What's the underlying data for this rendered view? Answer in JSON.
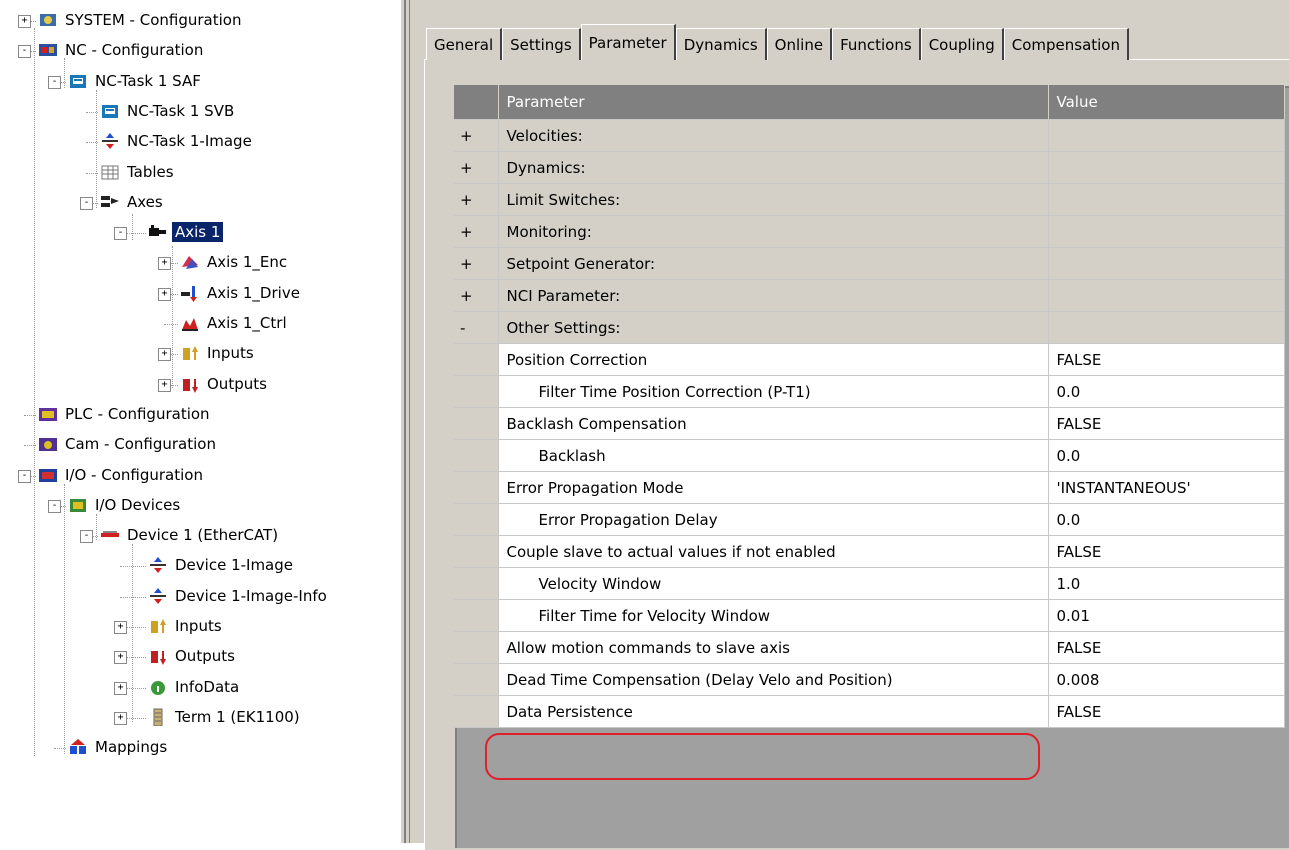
{
  "tree": [
    {
      "label": "SYSTEM - Configuration",
      "icon": "system-config-icon",
      "expander": "+"
    },
    {
      "label": "NC - Configuration",
      "icon": "nc-config-icon",
      "expander": "-"
    },
    {
      "label": "NC-Task 1 SAF",
      "icon": "task-icon",
      "expander": "-"
    },
    {
      "label": "NC-Task 1 SVB",
      "icon": "task-icon",
      "expander": ""
    },
    {
      "label": "NC-Task 1-Image",
      "icon": "image-icon",
      "expander": ""
    },
    {
      "label": "Tables",
      "icon": "table-icon",
      "expander": ""
    },
    {
      "label": "Axes",
      "icon": "axes-icon",
      "expander": "-"
    },
    {
      "label": "Axis 1",
      "icon": "axis-icon",
      "expander": "-",
      "selected": true
    },
    {
      "label": "Axis 1_Enc",
      "icon": "encoder-icon",
      "expander": "+"
    },
    {
      "label": "Axis 1_Drive",
      "icon": "drive-icon",
      "expander": "+"
    },
    {
      "label": "Axis 1_Ctrl",
      "icon": "controller-icon",
      "expander": ""
    },
    {
      "label": "Inputs",
      "icon": "inputs-icon",
      "expander": "+"
    },
    {
      "label": "Outputs",
      "icon": "outputs-icon",
      "expander": "+"
    },
    {
      "label": "PLC - Configuration",
      "icon": "plc-config-icon",
      "expander": ""
    },
    {
      "label": "Cam - Configuration",
      "icon": "cam-config-icon",
      "expander": ""
    },
    {
      "label": "I/O - Configuration",
      "icon": "io-config-icon",
      "expander": "-"
    },
    {
      "label": "I/O Devices",
      "icon": "io-devices-icon",
      "expander": "-"
    },
    {
      "label": "Device 1 (EtherCAT)",
      "icon": "ethercat-device-icon",
      "expander": "-"
    },
    {
      "label": "Device 1-Image",
      "icon": "image-icon",
      "expander": ""
    },
    {
      "label": "Device 1-Image-Info",
      "icon": "image-icon",
      "expander": ""
    },
    {
      "label": "Inputs",
      "icon": "inputs-icon",
      "expander": "+"
    },
    {
      "label": "Outputs",
      "icon": "outputs-icon",
      "expander": "+"
    },
    {
      "label": "InfoData",
      "icon": "infodata-icon",
      "expander": "+"
    },
    {
      "label": "Term 1 (EK1100)",
      "icon": "terminal-icon",
      "expander": "+"
    },
    {
      "label": "Mappings",
      "icon": "mappings-icon",
      "expander": ""
    }
  ],
  "tabs": [
    "General",
    "Settings",
    "Parameter",
    "Dynamics",
    "Online",
    "Functions",
    "Coupling",
    "Compensation"
  ],
  "active_tab": "Parameter",
  "grid": {
    "headers": {
      "parameter": "Parameter",
      "value": "Value"
    },
    "rows": [
      {
        "type": "group",
        "pm": "+",
        "name": "Velocities:",
        "value": ""
      },
      {
        "type": "group",
        "pm": "+",
        "name": "Dynamics:",
        "value": ""
      },
      {
        "type": "group",
        "pm": "+",
        "name": "Limit Switches:",
        "value": ""
      },
      {
        "type": "group",
        "pm": "+",
        "name": "Monitoring:",
        "value": ""
      },
      {
        "type": "group",
        "pm": "+",
        "name": "Setpoint Generator:",
        "value": ""
      },
      {
        "type": "group",
        "pm": "+",
        "name": "NCI Parameter:",
        "value": ""
      },
      {
        "type": "group",
        "pm": "-",
        "name": "Other Settings:",
        "value": ""
      },
      {
        "type": "item",
        "indent": false,
        "name": "Position Correction",
        "value": "FALSE"
      },
      {
        "type": "item",
        "indent": true,
        "name": "Filter Time Position Correction (P-T1)",
        "value": "0.0"
      },
      {
        "type": "item",
        "indent": false,
        "name": "Backlash Compensation",
        "value": "FALSE"
      },
      {
        "type": "item",
        "indent": true,
        "name": "Backlash",
        "value": "0.0"
      },
      {
        "type": "item",
        "indent": false,
        "name": "Error Propagation Mode",
        "value": "'INSTANTANEOUS'"
      },
      {
        "type": "item",
        "indent": true,
        "name": "Error Propagation Delay",
        "value": "0.0"
      },
      {
        "type": "item",
        "indent": false,
        "name": "Couple slave to actual values if not enabled",
        "value": "FALSE"
      },
      {
        "type": "item",
        "indent": true,
        "name": "Velocity Window",
        "value": "1.0"
      },
      {
        "type": "item",
        "indent": true,
        "name": "Filter Time for Velocity Window",
        "value": "0.01"
      },
      {
        "type": "item",
        "indent": false,
        "name": "Allow motion commands to slave axis",
        "value": "FALSE"
      },
      {
        "type": "item",
        "indent": false,
        "name": "Dead Time Compensation (Delay Velo and Position)",
        "value": "0.008",
        "highlighted": true
      },
      {
        "type": "item",
        "indent": false,
        "name": "Data Persistence",
        "value": "FALSE"
      }
    ]
  },
  "colors": {
    "selection": "#0a246a",
    "highlight_ring": "#e0202a",
    "panel": "#d4d0c8"
  }
}
